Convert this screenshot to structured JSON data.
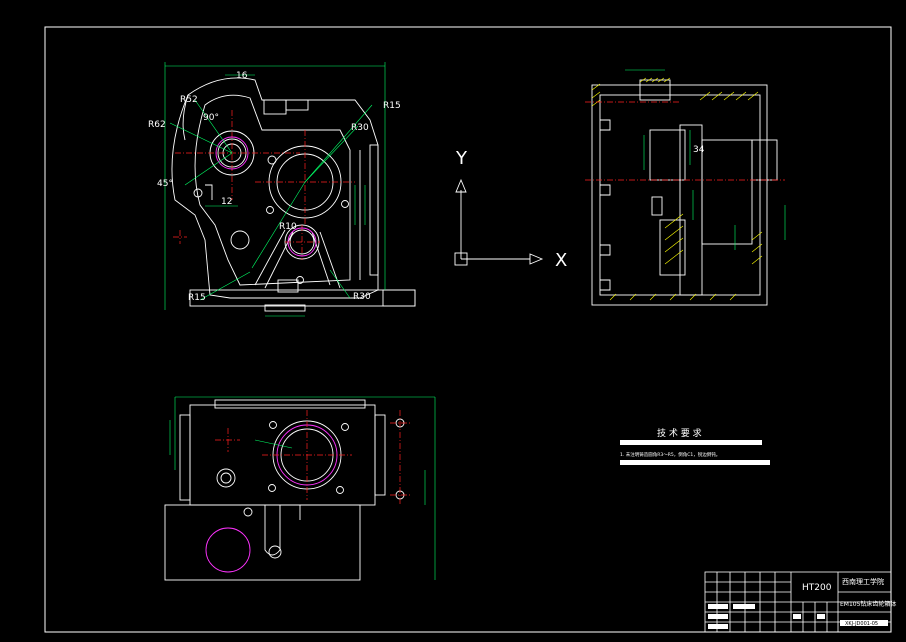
{
  "labels": {
    "r52": "R52",
    "r62": "R62",
    "r15_top": "R15",
    "r30_top": "R30",
    "r10": "R10",
    "r15_bottom": "R15",
    "r30_bottom": "R30",
    "angle_90": "90°",
    "angle_45": "45°",
    "dim_12": "12",
    "dim_16": "16",
    "dim_34": "34",
    "axis_y": "Y",
    "axis_x": "X"
  },
  "tech": {
    "title": "技 术 要 求",
    "note": "1. 未注明铸造圆角R3～R5，倒角C1，锐边倒钝。"
  },
  "title_block": {
    "material": "HT200",
    "school": "西南理工学院",
    "part_name": "EM105钻床齿轮箱体",
    "drawing_no": "XKJ-JD001-05"
  },
  "colors": {
    "background": "#000000",
    "outline": "#ffffff",
    "center_line": "#ff2020",
    "dimension": "#00ff66",
    "hidden": "#ff33ff",
    "hatch": "#ffff00"
  }
}
